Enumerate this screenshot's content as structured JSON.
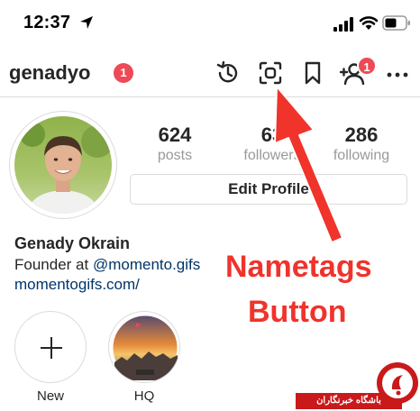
{
  "status_bar": {
    "time": "12:37"
  },
  "header": {
    "username": "genadyo",
    "notification_badge": "1",
    "add_user_badge": "1"
  },
  "profile": {
    "stats": [
      {
        "value": "624",
        "label": "posts"
      },
      {
        "value": "63",
        "label": "followers"
      },
      {
        "value": "286",
        "label": "following"
      }
    ],
    "edit_profile_label": "Edit Profile",
    "full_name": "Genady Okrain",
    "bio_prefix": "Founder at ",
    "bio_mention": "@momento.gifs",
    "website": "momentogifs.com/"
  },
  "stories": [
    {
      "label": "New"
    },
    {
      "label": "HQ"
    }
  ],
  "annotation": {
    "line1": "Nametags",
    "line2": "Button"
  },
  "watermark": {
    "text": "باشگاه خبرنگاران"
  },
  "colors": {
    "badge": "#ed4956",
    "link": "#003569",
    "annotation": "#f0332b"
  }
}
